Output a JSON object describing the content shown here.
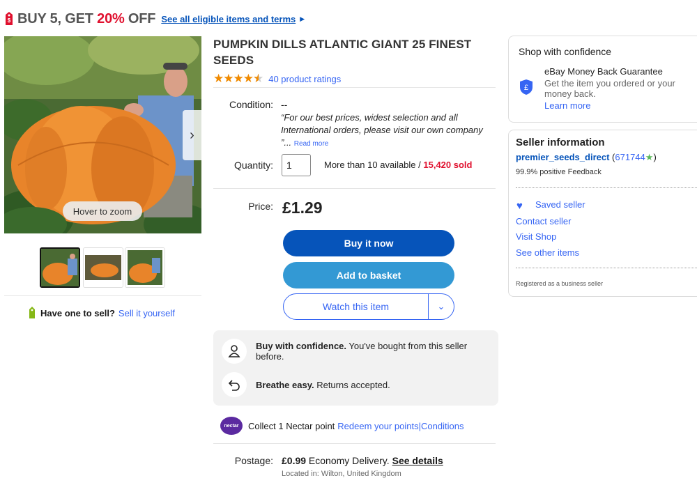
{
  "promo": {
    "headline_prefix": "BUY 5, GET ",
    "headline_pct": "20%",
    "headline_suffix": " OFF",
    "terms_link": "See all eligible items and terms"
  },
  "gallery": {
    "zoom_hint": "Hover to zoom",
    "thumbnail_count": 3,
    "selected_thumbnail": 1
  },
  "sell_prompt": {
    "question": "Have one to sell?",
    "link": "Sell it yourself"
  },
  "listing": {
    "title": "PUMPKIN DILLS ATLANTIC GIANT 25 FINEST SEEDS",
    "rating_stars": 4.5,
    "ratings_link": "40 product ratings",
    "condition_label": "Condition:",
    "condition_value": "--",
    "condition_desc": "“For our best prices, widest selection and all International orders, please visit our own company ”...",
    "read_more": "Read more",
    "quantity_label": "Quantity:",
    "quantity_value": "1",
    "availability": "More than 10 available / ",
    "sold": "15,420 sold",
    "price_label": "Price:",
    "price": "£1.29"
  },
  "actions": {
    "buy_now": "Buy it now",
    "add_to_basket": "Add to basket",
    "watch": "Watch this item"
  },
  "confidence": {
    "row1_bold": "Buy with confidence.",
    "row1_text": " You've bought from this seller before.",
    "row2_bold": "Breathe easy.",
    "row2_text": " Returns accepted."
  },
  "nectar": {
    "logo_text": "nectar",
    "text": "Collect 1 Nectar point",
    "redeem_link": "Redeem your points",
    "separator": " | ",
    "conditions_link": "Conditions"
  },
  "postage": {
    "label": "Postage:",
    "price": "£0.99",
    "method": " Economy Delivery.",
    "details_link": "See details",
    "location": "Located in: Wilton, United Kingdom"
  },
  "shop_confidence": {
    "title": "Shop with confidence",
    "guarantee_title": "eBay Money Back Guarantee",
    "guarantee_desc": "Get the item you ordered or your money back.",
    "learn_more": "Learn more"
  },
  "seller": {
    "title": "Seller information",
    "name": "premier_seeds_direct",
    "score": "671744",
    "feedback": "99.9% positive Feedback",
    "saved": "Saved seller",
    "contact": "Contact seller",
    "visit_shop": "Visit Shop",
    "other_items": "See other items",
    "registered": "Registered as a business seller"
  },
  "colors": {
    "accent_blue": "#3665f3",
    "buy_blue": "#0654ba",
    "basket_blue": "#3399d4",
    "sold_red": "#e0102e",
    "star_orange": "#f08a00"
  }
}
